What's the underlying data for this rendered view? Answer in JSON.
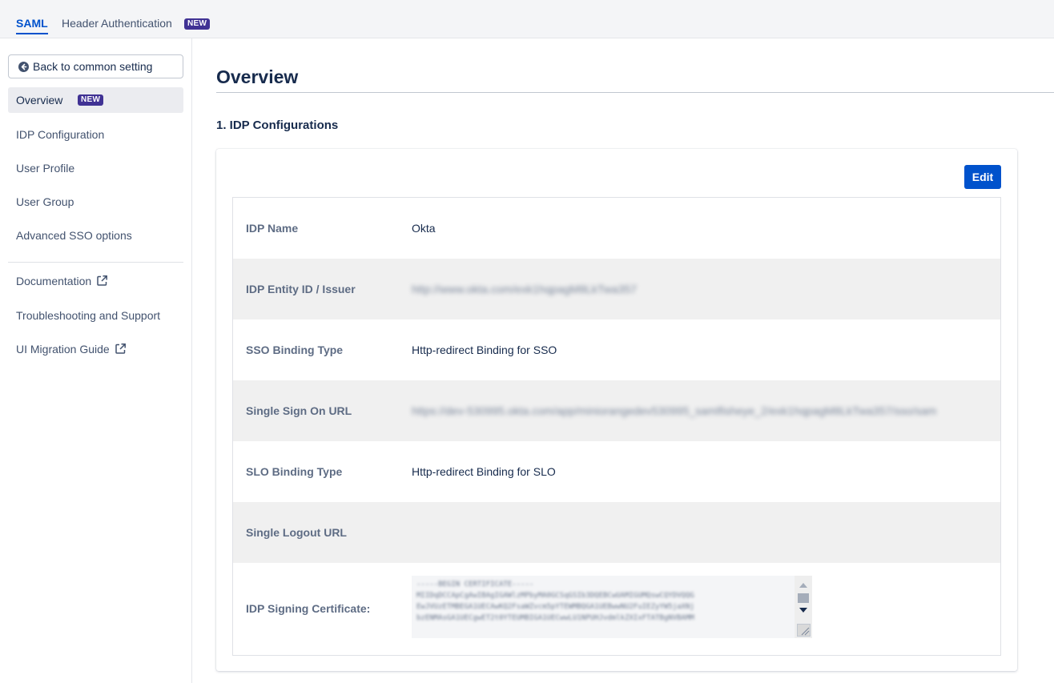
{
  "tabs": [
    {
      "label": "SAML",
      "active": true
    },
    {
      "label": "Header Authentication",
      "badge": "NEW"
    }
  ],
  "sidebar": {
    "back_label": "Back to common setting",
    "items": [
      {
        "label": "Overview",
        "badge": "NEW",
        "active": true
      },
      {
        "label": "IDP Configuration"
      },
      {
        "label": "User Profile"
      },
      {
        "label": "User Group"
      },
      {
        "label": "Advanced SSO options"
      }
    ],
    "links": [
      {
        "label": "Documentation",
        "icon": "external-link-icon"
      },
      {
        "label": "Troubleshooting and Support"
      },
      {
        "label": "UI Migration Guide",
        "icon": "external-link-icon"
      }
    ]
  },
  "main": {
    "title": "Overview",
    "section_title": "1. IDP Configurations",
    "edit_label": "Edit",
    "rows": [
      {
        "key": "IDP Name",
        "value": "Okta"
      },
      {
        "key": "IDP Entity ID / Issuer",
        "value": "http://www.okta.com/exk1hqpagM8LkTwa357",
        "obscured": true
      },
      {
        "key": "SSO Binding Type",
        "value": "Http-redirect Binding for SSO"
      },
      {
        "key": "Single Sign On URL",
        "value": "https://dev-530995.okta.com/app/miniorangedev530995_samlfisheye_2/exk1hqpagM8LkTwa357/sso/saml",
        "obscured": true
      },
      {
        "key": "SLO Binding Type",
        "value": "Http-redirect Binding for SLO"
      },
      {
        "key": "Single Logout URL",
        "value": ""
      },
      {
        "key": "IDP Signing Certificate:",
        "value": "-----BEGIN CERTIFICATE-----\nMIIDqDCCApCgAwIBAgIGAWlzMPbyMA0GCSqGSIb3DQEBCwUAMIGUMQswCQYDVQQG\nEwJVUzETMBEGA1UECAwKQ2FsaWZvcm5pYTEWMBQGA1UEBwwNU2FuIEZyYW5jaXNj\nbzENMAsGA1UECgwET2t0YTEUMBIGA1UECwwLU1NPUHJvdmlkZXIxFTATBgNVBAMM",
        "obscured": true
      }
    ]
  },
  "colors": {
    "accent": "#0052cc",
    "badge": "#403294"
  }
}
